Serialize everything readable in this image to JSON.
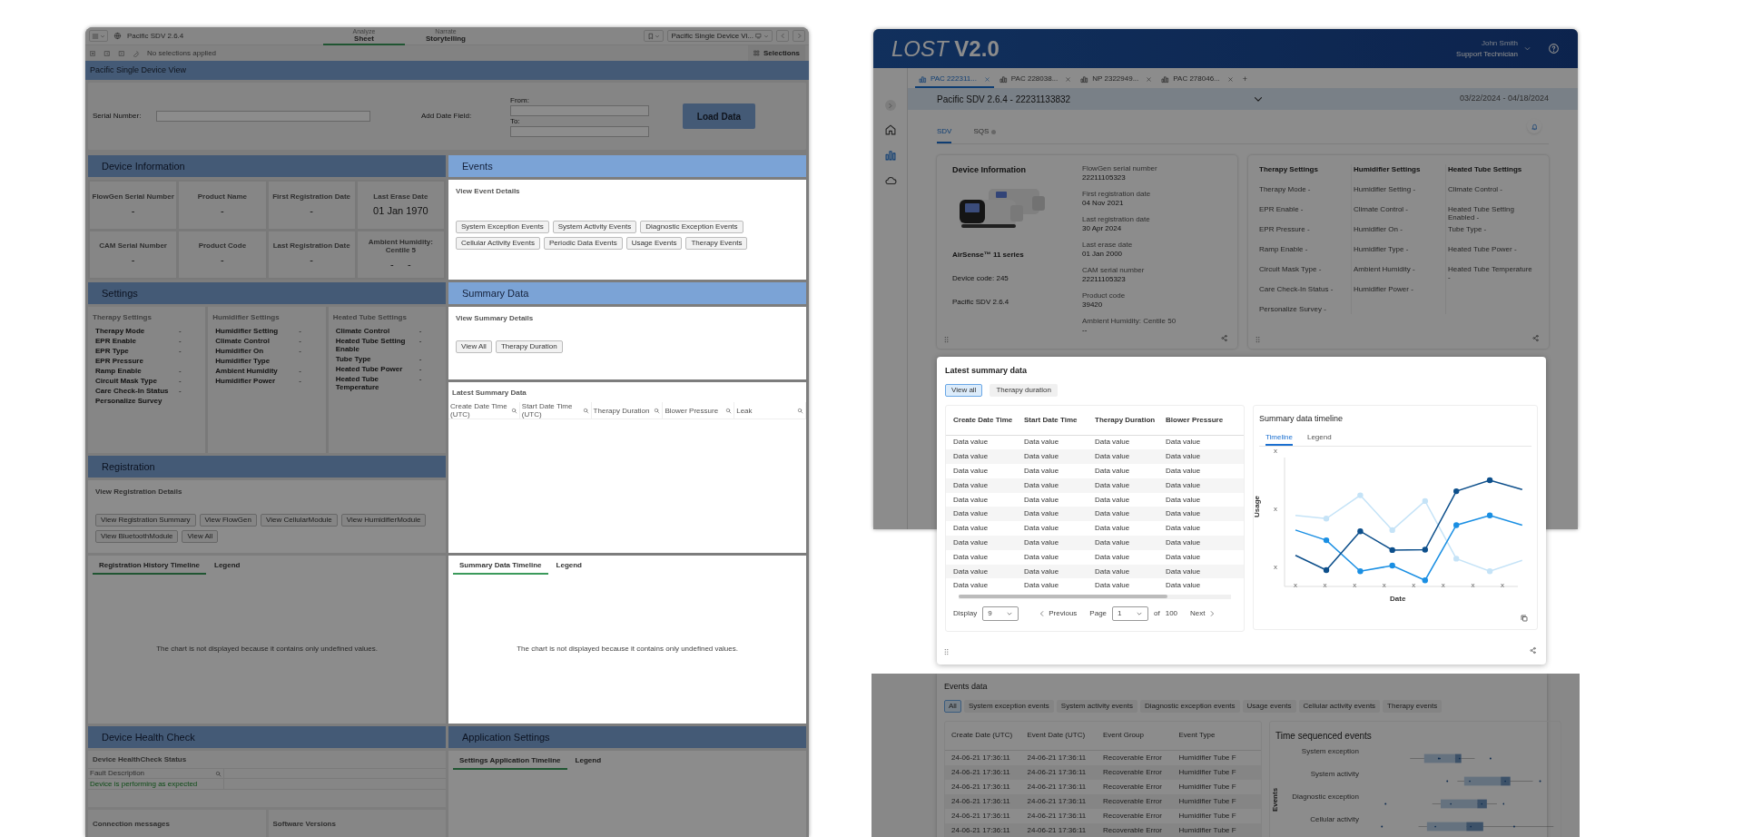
{
  "left": {
    "top_dimmed": true,
    "app_name": "Pacific SDV 2.6.4",
    "modes": [
      {
        "caption": "Analyze",
        "label": "Sheet",
        "selected": true
      },
      {
        "caption": "Narrate",
        "label": "Storytelling",
        "selected": false
      }
    ],
    "sheet_name": "Pacific Single Device Vi...",
    "selection_status": "No selections applied",
    "selections_label": "Selections",
    "page_title": "Pacific Single Device View",
    "serial_label": "Serial Number:",
    "date_field_label": "Add Date Field:",
    "from_label": "From:",
    "to_label": "To:",
    "load_button": "Load Data",
    "rows": [
      {
        "cells": [
          [
            {
              "kind": "header",
              "title": "Device Information",
              "dimmed": true
            }
          ],
          [
            {
              "kind": "header",
              "title": "Events",
              "dimmed": false
            }
          ]
        ]
      },
      {
        "cells": [
          [
            {
              "kind": "kpis",
              "dimmed": true,
              "items": [
                {
                  "label": "FlowGen Serial Number",
                  "value": "-"
                },
                {
                  "label": "Product Name",
                  "value": "-"
                },
                {
                  "label": "First Registration Date",
                  "value": "-"
                },
                {
                  "label": "Last Erase Date",
                  "value": "01 Jan 1970"
                },
                {
                  "label": "CAM Serial Number",
                  "value": "-"
                },
                {
                  "label": "Product Code",
                  "value": "-"
                },
                {
                  "label": "Last Registration Date",
                  "value": "-"
                },
                {
                  "label": "Ambient Humidity: Centile 5",
                  "value": "-     -"
                }
              ]
            }
          ],
          [
            {
              "kind": "buttons",
              "dimmed": false,
              "title": "View Event Details",
              "buttons": [
                "System Exception Events",
                "System Activity Events",
                "Diagnostic Exception Events",
                "Cellular Activity Events",
                "Periodic Data Events",
                "Usage Events",
                "Therapy Events"
              ]
            }
          ]
        ]
      },
      {
        "cells": [
          [
            {
              "kind": "header",
              "title": "Settings",
              "dimmed": true
            }
          ],
          [
            {
              "kind": "header",
              "title": "Summary Data",
              "dimmed": false
            }
          ]
        ]
      },
      {
        "cells": [
          [
            {
              "kind": "settings",
              "dimmed": true,
              "groups": [
                {
                  "title": "Therapy Settings",
                  "rows": [
                    {
                      "label": "Therapy Mode",
                      "value": "-"
                    },
                    {
                      "label": "EPR Enable",
                      "value": "-"
                    },
                    {
                      "label": "EPR Type",
                      "value": "-"
                    },
                    {
                      "label": "EPR Pressure"
                    },
                    {
                      "label": "Ramp Enable",
                      "value": "-"
                    },
                    {
                      "label": "Circuit Mask Type",
                      "value": "-"
                    },
                    {
                      "label": "Care Check-In Status",
                      "value": "-"
                    },
                    {
                      "label": "Personalize Survey"
                    }
                  ]
                },
                {
                  "title": "Humidifier Settings",
                  "rows": [
                    {
                      "label": "Humidifier Setting",
                      "value": "-"
                    },
                    {
                      "label": "Climate Control",
                      "value": "-"
                    },
                    {
                      "label": "Humidifier On",
                      "value": "-"
                    },
                    {
                      "label": "Humidifier Type"
                    },
                    {
                      "label": "Ambient Humidity",
                      "value": "-"
                    },
                    {
                      "label": "Humidifier Power",
                      "value": "-"
                    }
                  ]
                },
                {
                  "title": "Heated Tube Settings",
                  "rows": [
                    {
                      "label": "Climate Control",
                      "value": "-"
                    },
                    {
                      "label": "Heated Tube Setting Enable",
                      "value": "-"
                    },
                    {
                      "label": "Tube Type",
                      "value": "-"
                    },
                    {
                      "label": "Heated Tube Power",
                      "value": "-"
                    },
                    {
                      "label": "Heated Tube Temperature",
                      "value": "-"
                    }
                  ]
                }
              ]
            },
            {
              "kind": "header",
              "title": "Registration",
              "dimmed": true
            },
            {
              "kind": "buttons",
              "dimmed": true,
              "title": "View Registration Details",
              "buttons": [
                "View Registration Summary",
                "View FlowGen",
                "View CellularModule",
                "View HumidifierModule",
                "View BluetoothModule",
                "View All"
              ]
            }
          ],
          [
            {
              "kind": "buttons",
              "dimmed": false,
              "title": "View Summary Details",
              "buttons": [
                "View All",
                "Therapy Duration"
              ]
            },
            {
              "kind": "table",
              "dimmed": false,
              "title": "Latest Summary Data",
              "columns": [
                "Create Date Time (UTC)",
                "Start Date Time (UTC)",
                "Therapy Duration",
                "Blower Pressure",
                "Leak"
              ]
            }
          ]
        ]
      },
      {
        "cells": [
          [
            {
              "kind": "timeline",
              "dimmed": true,
              "tabs": [
                {
                  "label": "Registration History Timeline",
                  "selected": true
                },
                {
                  "label": "Legend",
                  "selected": false
                }
              ],
              "message": "The chart is not displayed because it contains only undefined values."
            }
          ],
          [
            {
              "kind": "timeline",
              "dimmed": false,
              "tabs": [
                {
                  "label": "Summary Data Timeline",
                  "selected": true
                },
                {
                  "label": "Legend",
                  "selected": false
                }
              ],
              "message": "The chart is not displayed because it contains only undefined values."
            }
          ]
        ]
      },
      {
        "cells": [
          [
            {
              "kind": "header",
              "title": "Device Health Check",
              "dimmed": true
            }
          ],
          [
            {
              "kind": "header",
              "title": "Application Settings",
              "dimmed": true
            }
          ]
        ]
      },
      {
        "cells": [
          [
            {
              "kind": "health",
              "dimmed": true,
              "title": "Device HealthCheck Status",
              "column": "Fault Description",
              "rows": [
                "Device is performing as expected"
              ],
              "subpanels": [
                "Connection messages",
                "Software Versions"
              ]
            }
          ],
          [
            {
              "kind": "timeline",
              "dimmed": true,
              "tabs": [
                {
                  "label": "Settings Application Timeline",
                  "selected": true
                },
                {
                  "label": "Legend",
                  "selected": false
                }
              ]
            }
          ]
        ]
      }
    ]
  },
  "app": {
    "dimmed": true,
    "logo_light": "LOST",
    "logo_bold": "V2.0",
    "user_name": "John Smith",
    "user_role": "Support Technician",
    "tabs": [
      {
        "label": "PAC 222311...",
        "selected": true
      },
      {
        "label": "PAC 228038...",
        "selected": false
      },
      {
        "label": "NP 2322949...",
        "selected": false
      },
      {
        "label": "PAC 278046...",
        "selected": false
      }
    ],
    "add_tab": "+",
    "context_title": "Pacific SDV 2.6.4 - 22231133832",
    "date_range": "03/22/2024 - 04/18/2024",
    "nav": [
      {
        "kind": "home",
        "selected": false
      },
      {
        "kind": "chart",
        "selected": true
      },
      {
        "kind": "cloud",
        "selected": false
      }
    ],
    "view_tabs": [
      {
        "label": "SDV",
        "selected": true,
        "dot": false
      },
      {
        "label": "SQS",
        "selected": false,
        "dot": true
      }
    ],
    "device": {
      "title": "Device Information",
      "model": "AirSense™ 11 series",
      "code": "Device code: 245",
      "version": "Pacific SDV 2.6.4",
      "fields": [
        {
          "label": "FlowGen serial number",
          "value": "22211105323"
        },
        {
          "label": "First registration date",
          "value": "04 Nov 2021"
        },
        {
          "label": "Last registration date",
          "value": "30 Apr 2024"
        },
        {
          "label": "Last erase date",
          "value": "01 Jan 2000"
        },
        {
          "label": "CAM serial number",
          "value": "22211105323"
        },
        {
          "label": "Product code",
          "value": "39420"
        },
        {
          "label": "Ambient Humidity: Centile 50",
          "value": "--"
        }
      ]
    },
    "settings_groups": [
      {
        "title": "Therapy Settings",
        "items": [
          "Therapy Mode -",
          "EPR Enable -",
          "EPR Pressure -",
          "Ramp Enable -",
          "Circuit Mask Type -",
          "Care Check-In Status -",
          "Personalize Survey -"
        ]
      },
      {
        "title": "Humidifier Settings",
        "items": [
          "Humidifier Setting -",
          "Climate Control -",
          "Humidifier On -",
          "Humidifier Type -",
          "Ambient Humidity -",
          "Humidifier Power -"
        ]
      },
      {
        "title": "Heated Tube Settings",
        "items": [
          "Climate Control -",
          "Heated Tube Setting Enabled -",
          "Tube Type -",
          "Heated Tube Power -",
          "Heated Tube Temperature -"
        ]
      }
    ]
  },
  "summary": {
    "dimmed": false,
    "title": "Latest summary data",
    "filters": [
      {
        "label": "View all",
        "selected": true
      },
      {
        "label": "Therapy duration",
        "selected": false
      }
    ],
    "columns": [
      "Create Date Time",
      "Start Date Time",
      "Therapy Duration",
      "Blower Pressure"
    ],
    "rows": [
      [
        "Data value",
        "Data value",
        "Data value",
        "Data value"
      ],
      [
        "Data value",
        "Data value",
        "Data value",
        "Data value"
      ],
      [
        "Data value",
        "Data value",
        "Data value",
        "Data value"
      ],
      [
        "Data value",
        "Data value",
        "Data value",
        "Data value"
      ],
      [
        "Data value",
        "Data value",
        "Data value",
        "Data value"
      ],
      [
        "Data value",
        "Data value",
        "Data value",
        "Data value"
      ],
      [
        "Data value",
        "Data value",
        "Data value",
        "Data value"
      ],
      [
        "Data value",
        "Data value",
        "Data value",
        "Data value"
      ],
      [
        "Data value",
        "Data value",
        "Data value",
        "Data value"
      ],
      [
        "Data value",
        "Data value",
        "Data value",
        "Data value"
      ],
      [
        "Data value",
        "Data value",
        "Data value",
        "Data value"
      ]
    ],
    "display_label": "Display",
    "display_value": "9",
    "previous": "Previous",
    "page_label": "Page",
    "page_value": "1",
    "of_label": "of",
    "page_total": "100",
    "next": "Next",
    "chart": {
      "title": "Summary data timeline",
      "tabs": [
        {
          "label": "Timeline",
          "selected": true
        },
        {
          "label": "Legend",
          "selected": false
        }
      ],
      "ylabel": "Usage",
      "xlabel": "Date",
      "yticks": [
        "x",
        "x",
        "x"
      ],
      "xticks": [
        "x",
        "x",
        "x",
        "x",
        "x",
        "x",
        "x",
        "x"
      ]
    }
  },
  "events": {
    "dimmed": true,
    "title": "Events data",
    "filters": [
      {
        "label": "All",
        "selected": true
      },
      {
        "label": "System exception events",
        "selected": false
      },
      {
        "label": "System activity events",
        "selected": false
      },
      {
        "label": "Diagnostic exception events",
        "selected": false
      },
      {
        "label": "Usage events",
        "selected": false
      },
      {
        "label": "Cellular activity events",
        "selected": false
      },
      {
        "label": "Therapy events",
        "selected": false
      }
    ],
    "columns": [
      "Create Date (UTC)",
      "Event Date (UTC)",
      "Event Group",
      "Event Type"
    ],
    "rows": [
      [
        "24-06-21 17:36:11",
        "24-06-21 17:36:11",
        "Recoverable Error",
        "Humidifier Tube F"
      ],
      [
        "24-06-21 17:36:11",
        "24-06-21 17:36:11",
        "Recoverable Error",
        "Humidifier Tube F"
      ],
      [
        "24-06-21 17:36:11",
        "24-06-21 17:36:11",
        "Recoverable Error",
        "Humidifier Tube F"
      ],
      [
        "24-06-21 17:36:11",
        "24-06-21 17:36:11",
        "Recoverable Error",
        "Humidifier Tube F"
      ],
      [
        "24-06-21 17:36:11",
        "24-06-21 17:36:11",
        "Recoverable Error",
        "Humidifier Tube F"
      ],
      [
        "24-06-21 17:36:11",
        "24-06-21 17:36:11",
        "Recoverable Error",
        "Humidifier Tube F"
      ]
    ],
    "chart": {
      "title": "Time sequenced events",
      "ylabel": "Events",
      "categories": [
        "System exception",
        "System activity",
        "Diagnostic exception",
        "Cellular activity"
      ]
    }
  }
}
